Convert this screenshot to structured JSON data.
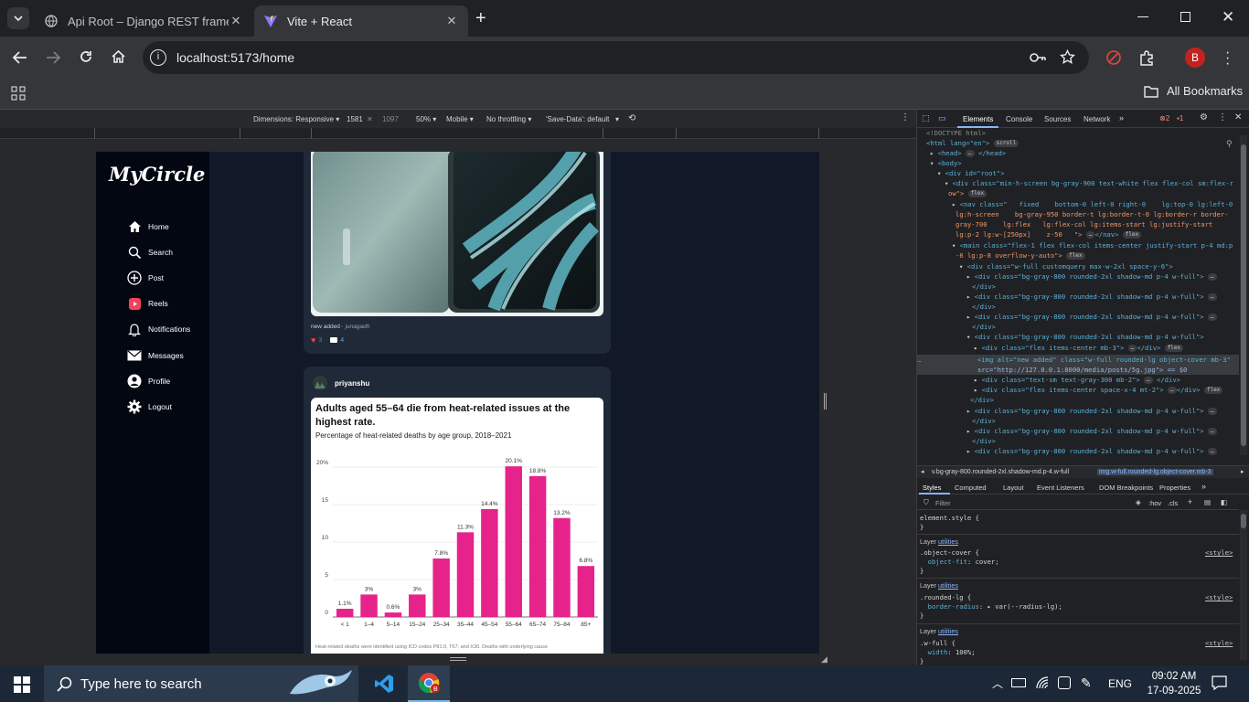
{
  "browser": {
    "tabs": [
      {
        "title": "Api Root – Django REST framew",
        "active": false
      },
      {
        "title": "Vite + React",
        "active": true
      }
    ],
    "url": "localhost:5173/home",
    "bookmarks_label": "All Bookmarks",
    "profile_initial": "B"
  },
  "device_toolbar": {
    "dimensions": "Dimensions: Responsive",
    "width": "1581",
    "height": "1097",
    "zoom": "50%",
    "device": "Mobile",
    "throttling": "No throttling",
    "save_data": "'Save-Data': default"
  },
  "app": {
    "brand": "MyCircle",
    "nav": [
      {
        "label": "Home",
        "icon": "home-icon"
      },
      {
        "label": "Search",
        "icon": "search-icon"
      },
      {
        "label": "Post",
        "icon": "plus-circle-icon"
      },
      {
        "label": "Reels",
        "icon": "reels-icon"
      },
      {
        "label": "Notifications",
        "icon": "bell-icon"
      },
      {
        "label": "Messages",
        "icon": "envelope-icon"
      },
      {
        "label": "Profile",
        "icon": "user-icon"
      },
      {
        "label": "Logout",
        "icon": "gear-icon"
      }
    ],
    "post1": {
      "caption": "new added · ",
      "location": "junagadh",
      "likes": "3",
      "comments": "4"
    },
    "post2": {
      "username": "priyanshu"
    }
  },
  "chart_data": {
    "type": "bar",
    "title": "Adults aged 55–64 die from heat-related issues at the highest rate.",
    "subtitle": "Percentage of heat-related deaths by age group, 2018–2021",
    "categories": [
      "< 1",
      "1–4",
      "5–14",
      "15–24",
      "25–34",
      "35–44",
      "45–54",
      "55–64",
      "65–74",
      "75–84",
      "85+"
    ],
    "values": [
      1.1,
      3,
      0.6,
      3,
      7.8,
      11.3,
      14.4,
      20.1,
      18.8,
      13.2,
      6.8
    ],
    "labels": [
      "1.1%",
      "3%",
      "0.6%",
      "3%",
      "7.8%",
      "11.3%",
      "14.4%",
      "20.1%",
      "18.8%",
      "13.2%",
      "6.8%"
    ],
    "yticks": [
      "20%",
      "15",
      "10",
      "5",
      "0"
    ],
    "ylim": [
      0,
      20
    ],
    "color": "#e6238a",
    "footnote": "Heat-related deaths were identified using ICD codes P81.0, T67, and X30. Deaths with underlying cause"
  },
  "devtools": {
    "tabs": [
      "Elements",
      "Console",
      "Sources",
      "Network"
    ],
    "errors": "2",
    "warnings": "1",
    "dom_lines": [
      "<!DOCTYPE html>",
      "<html lang=\"en\">",
      "<head>",
      "</head>",
      "<body>",
      "<div id=\"root\">",
      "<div class=\"min-h-screen bg-gray-900 text-white flex flex-col sm:flex-r",
      "ow\">",
      "<nav class=\"   fixed    bottom-0 left-0 right-0    lg:top-0 lg:left-0",
      "lg:h-screen    bg-gray-950 border-t lg:border-t-0 lg:border-r border-",
      "gray-700    lg:flex   lg:flex-col lg:items-start lg:justify-start",
      "lg:p-2 lg:w-[250px]    z-50   \">",
      "</nav>",
      "<main class=\"flex-1 flex flex-col items-center justify-start p-4 md:p",
      "-6 lg:p-8 overflow-y-auto\">",
      "<div class=\"w-full customquery max-w-2xl space-y-6\">",
      "<div class=\"bg-gray-800 rounded-2xl shadow-md p-4 w-full\">",
      "</div>",
      "<div class=\"bg-gray-800 rounded-2xl shadow-md p-4 w-full\">",
      "</div>",
      "<div class=\"bg-gray-800 rounded-2xl shadow-md p-4 w-full\">",
      "</div>",
      "<div class=\"bg-gray-800 rounded-2xl shadow-md p-4 w-full\">",
      "<div class=\"flex items-center mb-3\">",
      "</div>",
      "<img alt=\"new added\" class=\"w-full rounded-lg object-cover mb-3\"",
      "src=\"http://127.0.0.1:8000/media/posts/5g.jpg\"> == $0",
      "<div class=\"text-sm text-gray-300 mb-2\">",
      "</div>",
      "<div class=\"flex items-center space-x-4 mt-2\">",
      "</div>",
      "</div>",
      "<div class=\"bg-gray-800 rounded-2xl shadow-md p-4 w-full\">",
      "</div>",
      "<div class=\"bg-gray-800 rounded-2xl shadow-md p-4 w-full\">",
      "</div>",
      "<div class=\"bg-gray-800 rounded-2xl shadow-md p-4 w-full\">"
    ],
    "breadcrumb": [
      "v.bg-gray-800.rounded-2xl.shadow-md.p-4.w-full",
      "img.w-full.rounded-lg.object-cover.mb-3"
    ],
    "style_tabs": [
      "Styles",
      "Computed",
      "Layout",
      "Event Listeners",
      "DOM Breakpoints",
      "Properties"
    ],
    "filter_placeholder": "Filter",
    "hov": ":hov",
    "cls": ".cls",
    "rules": {
      "element_style": "element.style {",
      "layer_label": "Layer",
      "layer_link": "utilities",
      "source": "<style>",
      "r1_sel": ".object-cover {",
      "r1_prop": "object-fit",
      "r1_val": "cover;",
      "r2_sel": ".rounded-lg {",
      "r2_prop": "border-radius",
      "r2_val": "var(--radius-lg);",
      "r3_sel": ".w-full {",
      "r3_prop": "width",
      "r3_val": "100%;",
      "close": "}"
    }
  },
  "taskbar": {
    "search_placeholder": "Type here to search",
    "lang": "ENG",
    "time": "09:02 AM",
    "date": "17-09-2025"
  }
}
